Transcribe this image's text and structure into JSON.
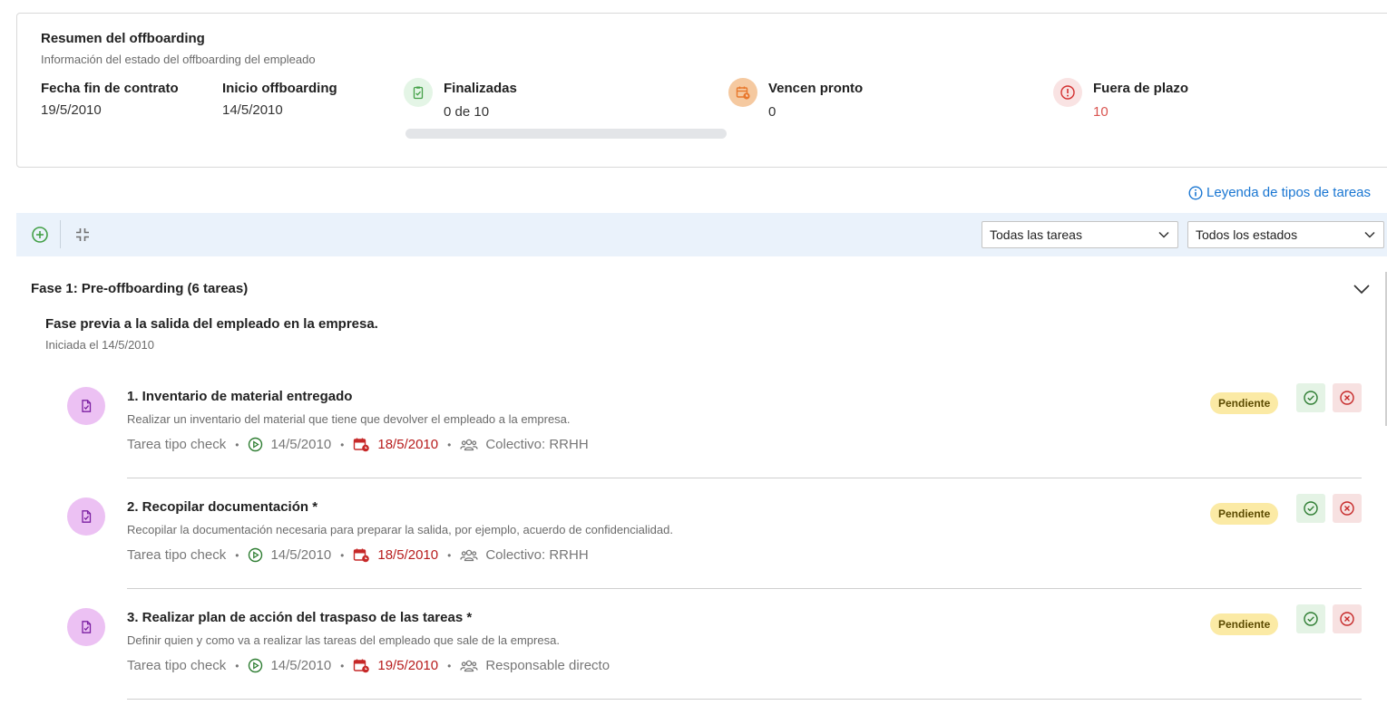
{
  "summary": {
    "title": "Resumen del offboarding",
    "subtitle": "Información del estado del offboarding del empleado",
    "contract_end_label": "Fecha fin de contrato",
    "contract_end_value": "19/5/2010",
    "offboarding_start_label": "Inicio offboarding",
    "offboarding_start_value": "14/5/2010",
    "finished_label": "Finalizadas",
    "finished_value": "0 de 10",
    "finished_progress": 0,
    "due_soon_label": "Vencen pronto",
    "due_soon_value": "0",
    "overdue_label": "Fuera de plazo",
    "overdue_value": "10"
  },
  "legend_link": "Leyenda de tipos de tareas",
  "toolbar": {
    "task_filter": "Todas las tareas",
    "status_filter": "Todos los estados"
  },
  "phase": {
    "title": "Fase 1: Pre-offboarding (6 tareas)",
    "description": "Fase previa a la salida del empleado en la empresa.",
    "started": "Iniciada el 14/5/2010"
  },
  "tasks": [
    {
      "title": "1. Inventario de material entregado",
      "description": "Realizar un inventario del material que tiene que devolver el empleado a la empresa.",
      "type": "Tarea tipo check",
      "start": "14/5/2010",
      "due": "18/5/2010",
      "assignee": "Colectivo: RRHH",
      "status": "Pendiente"
    },
    {
      "title": "2. Recopilar documentación *",
      "description": "Recopilar la documentación necesaria para preparar la salida, por ejemplo, acuerdo de confidencialidad.",
      "type": "Tarea tipo check",
      "start": "14/5/2010",
      "due": "18/5/2010",
      "assignee": "Colectivo: RRHH",
      "status": "Pendiente"
    },
    {
      "title": "3. Realizar plan de acción del traspaso de las tareas *",
      "description": "Definir quien y como va a realizar las tareas del empleado que sale de la empresa.",
      "type": "Tarea tipo check",
      "start": "14/5/2010",
      "due": "19/5/2010",
      "assignee": "Responsable directo",
      "status": "Pendiente"
    }
  ],
  "colors": {
    "accent": "#1976d2",
    "toolbar_bg": "#eaf2fb",
    "success": "#2e7d32",
    "danger": "#c62828",
    "pending_badge": "#fbeaa5",
    "task_avatar": "#ecc1f3"
  },
  "icons": {
    "finished": "clipboard-check-icon",
    "due_soon": "calendar-clock-icon",
    "overdue": "alert-circle-icon",
    "add": "plus-circle-icon",
    "collapse": "collapse-icon",
    "task_type": "document-check-icon",
    "start": "play-circle-icon",
    "due": "calendar-clock-icon",
    "assignee": "group-icon"
  }
}
